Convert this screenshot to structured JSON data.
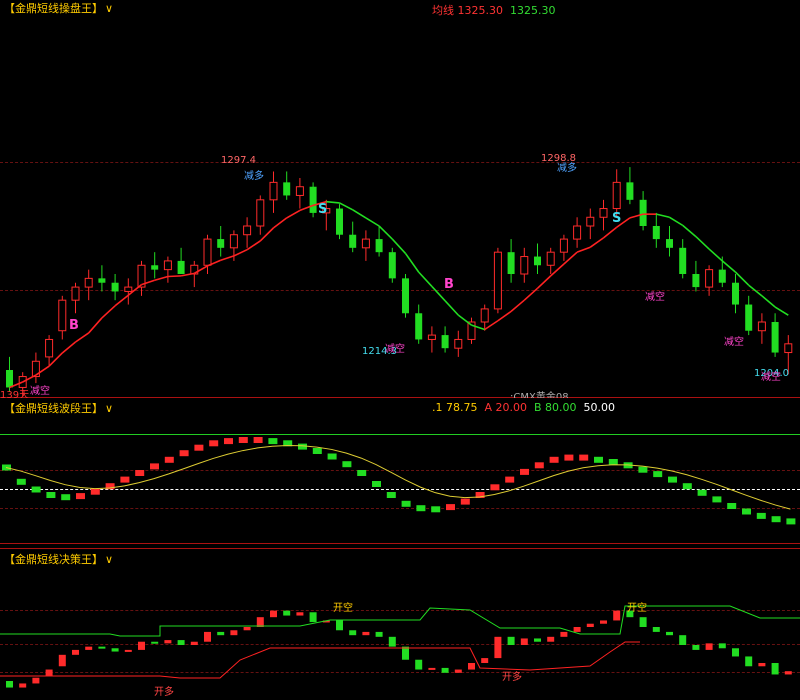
{
  "colors": {
    "bull": "#ff2b2b",
    "bear": "#22dd22",
    "ma_up": "#ff2222",
    "ma_down": "#22dd22",
    "signal_yellow": "#ddcc33",
    "title": "#ffcc00",
    "grid": "#aa1111"
  },
  "panel1": {
    "title": "【金鼎短线操盘王】",
    "chevron": "∨",
    "header_text": "均线",
    "header_value_red": "1325.30",
    "header_value_green": "1325.30",
    "days_label": "139天",
    "symbol": ":CMX黄金08",
    "annotations": {
      "peak1": "1297.4",
      "peak2": "1298.8",
      "trough1": "1214.3",
      "trough2": "1204.0",
      "jian_duo_1": "减多",
      "jian_duo_2": "减多",
      "jian_kong_1": "减空",
      "jian_kong_2": "减空",
      "jian_kong_3": "减空",
      "jian_kong_4": "减空",
      "jian_kong_5": "减空",
      "buy1": "B",
      "buy2": "B",
      "sell1": "S",
      "sell2": "S"
    }
  },
  "panel2": {
    "title": "【金鼎短线波段王】",
    "chevron": "∨",
    "v1": ".1 78.75",
    "a": "A 20.00",
    "b": "B 80.00",
    "c": "50.00"
  },
  "panel3": {
    "title": "【金鼎短线决策王】",
    "chevron": "∨",
    "kai_kong_1": "开空",
    "kai_kong_2": "开空",
    "kai_duo_1": "开多",
    "kai_duo_2": "开多"
  },
  "chart_data": {
    "type": "candlestick",
    "series": [
      {
        "name": "price",
        "values": [
          [
            1206,
            1212,
            1196,
            1198
          ],
          [
            1198,
            1205,
            1194,
            1203
          ],
          [
            1203,
            1214,
            1200,
            1210
          ],
          [
            1212,
            1222,
            1208,
            1220
          ],
          [
            1224,
            1240,
            1220,
            1238
          ],
          [
            1238,
            1246,
            1232,
            1244
          ],
          [
            1244,
            1252,
            1238,
            1248
          ],
          [
            1248,
            1254,
            1242,
            1246
          ],
          [
            1246,
            1250,
            1238,
            1242
          ],
          [
            1242,
            1248,
            1236,
            1244
          ],
          [
            1244,
            1256,
            1240,
            1254
          ],
          [
            1254,
            1260,
            1248,
            1252
          ],
          [
            1252,
            1258,
            1246,
            1256
          ],
          [
            1256,
            1262,
            1250,
            1250
          ],
          [
            1250,
            1256,
            1244,
            1254
          ],
          [
            1254,
            1268,
            1250,
            1266
          ],
          [
            1266,
            1272,
            1258,
            1262
          ],
          [
            1262,
            1270,
            1256,
            1268
          ],
          [
            1268,
            1276,
            1262,
            1272
          ],
          [
            1272,
            1286,
            1268,
            1284
          ],
          [
            1284,
            1297,
            1278,
            1292
          ],
          [
            1292,
            1297,
            1284,
            1286
          ],
          [
            1286,
            1294,
            1280,
            1290
          ],
          [
            1290,
            1292,
            1276,
            1278
          ],
          [
            1278,
            1284,
            1270,
            1280
          ],
          [
            1280,
            1282,
            1266,
            1268
          ],
          [
            1268,
            1274,
            1260,
            1262
          ],
          [
            1262,
            1270,
            1256,
            1266
          ],
          [
            1266,
            1272,
            1258,
            1260
          ],
          [
            1260,
            1262,
            1246,
            1248
          ],
          [
            1248,
            1250,
            1230,
            1232
          ],
          [
            1232,
            1236,
            1218,
            1220
          ],
          [
            1220,
            1226,
            1214,
            1222
          ],
          [
            1222,
            1226,
            1214,
            1216
          ],
          [
            1216,
            1224,
            1212,
            1220
          ],
          [
            1220,
            1230,
            1218,
            1228
          ],
          [
            1228,
            1236,
            1224,
            1234
          ],
          [
            1234,
            1262,
            1232,
            1260
          ],
          [
            1260,
            1266,
            1246,
            1250
          ],
          [
            1250,
            1262,
            1246,
            1258
          ],
          [
            1258,
            1264,
            1250,
            1254
          ],
          [
            1254,
            1262,
            1250,
            1260
          ],
          [
            1260,
            1268,
            1256,
            1266
          ],
          [
            1266,
            1276,
            1262,
            1272
          ],
          [
            1272,
            1280,
            1266,
            1276
          ],
          [
            1276,
            1284,
            1270,
            1280
          ],
          [
            1280,
            1298,
            1276,
            1292
          ],
          [
            1292,
            1299,
            1282,
            1284
          ],
          [
            1284,
            1288,
            1270,
            1272
          ],
          [
            1272,
            1278,
            1262,
            1266
          ],
          [
            1266,
            1272,
            1258,
            1262
          ],
          [
            1262,
            1266,
            1248,
            1250
          ],
          [
            1250,
            1256,
            1242,
            1244
          ],
          [
            1244,
            1254,
            1240,
            1252
          ],
          [
            1252,
            1258,
            1244,
            1246
          ],
          [
            1246,
            1250,
            1232,
            1236
          ],
          [
            1236,
            1240,
            1222,
            1224
          ],
          [
            1224,
            1232,
            1218,
            1228
          ],
          [
            1228,
            1232,
            1212,
            1214
          ],
          [
            1214,
            1222,
            1204,
            1218
          ]
        ]
      }
    ],
    "osc_values": [
      55,
      42,
      35,
      30,
      28,
      29,
      33,
      38,
      44,
      50,
      56,
      62,
      68,
      73,
      77,
      79,
      80,
      80,
      79,
      77,
      74,
      70,
      65,
      58,
      50,
      40,
      30,
      22,
      18,
      17,
      19,
      24,
      30,
      37,
      44,
      51,
      57,
      62,
      64,
      64,
      62,
      60,
      57,
      53,
      49,
      44,
      38,
      32,
      26,
      20,
      15,
      11,
      8,
      6
    ],
    "ylim": [
      1195,
      1305
    ]
  }
}
